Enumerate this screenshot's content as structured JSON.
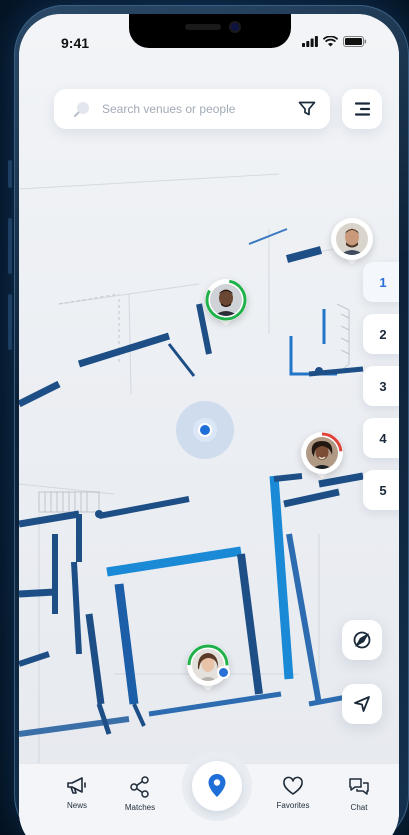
{
  "status": {
    "time": "9:41"
  },
  "search": {
    "placeholder": "Search venues or people"
  },
  "floors": [
    "1",
    "2",
    "3",
    "4",
    "5"
  ],
  "active_floor": "1",
  "nav": {
    "items": [
      {
        "label": "News",
        "icon": "megaphone-icon"
      },
      {
        "label": "Matches",
        "icon": "share-nodes-icon"
      },
      {
        "label": "Favorites",
        "icon": "heart-icon"
      },
      {
        "label": "Chat",
        "icon": "chat-bubbles-icon"
      }
    ],
    "center_icon": "location-pin-icon"
  },
  "colors": {
    "accent": "#1f6fd8",
    "wall": "#1d4f86",
    "wall_bright": "#1a8ad6",
    "online": "#21b14b",
    "busy": "#e0423c"
  }
}
